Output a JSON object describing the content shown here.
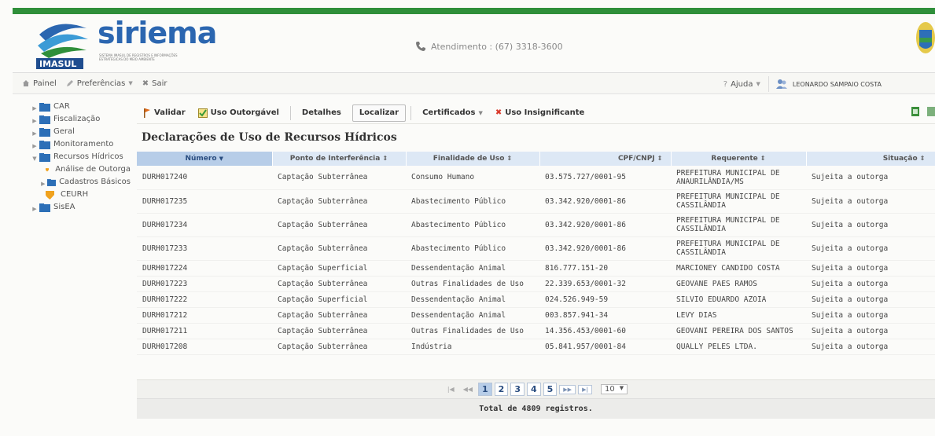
{
  "header": {
    "brand": "siriema",
    "logo_label": "IMASUL",
    "tagline": "Sistema Imasul de Registros e Informações Estratégicas do Meio Ambiente",
    "phone_text": "Atendimento : (67) 3318-3600"
  },
  "menubar": {
    "painel": "Painel",
    "preferencias": "Preferências",
    "sair": "Sair",
    "ajuda": "Ajuda",
    "user_name": "LEONARDO SAMPAIO COSTA"
  },
  "sidebar": {
    "car": "CAR",
    "fiscalizacao": "Fiscalização",
    "geral": "Geral",
    "monitoramento": "Monitoramento",
    "recursos_hidricos": "Recursos Hídricos",
    "analise_outorga": "Análise de Outorga",
    "cadastros_basicos": "Cadastros Básicos",
    "ceurh": "CEURH",
    "sisea": "SisEA"
  },
  "toolbar": {
    "validar": "Validar",
    "uso_outorgavel": "Uso Outorgável",
    "detalhes": "Detalhes",
    "localizar": "Localizar",
    "certificados": "Certificados",
    "uso_insignificante": "Uso Insignificante"
  },
  "page_title": "Declarações de Uso de Recursos Hídricos",
  "table": {
    "columns": [
      "Número",
      "Ponto de Interferência",
      "Finalidade de Uso",
      "CPF/CNPJ",
      "Requerente",
      "Situação"
    ],
    "rows": [
      [
        "DURH017240",
        "Captação Subterrânea",
        "Consumo Humano",
        "03.575.727/0001-95",
        "PREFEITURA MUNICIPAL DE ANAURILÂNDIA/MS",
        "Sujeita a outorga"
      ],
      [
        "DURH017235",
        "Captação Subterrânea",
        "Abastecimento Público",
        "03.342.920/0001-86",
        "PREFEITURA MUNICIPAL DE CASSILÂNDIA",
        "Sujeita a outorga"
      ],
      [
        "DURH017234",
        "Captação Subterrânea",
        "Abastecimento Público",
        "03.342.920/0001-86",
        "PREFEITURA MUNICIPAL DE CASSILÂNDIA",
        "Sujeita a outorga"
      ],
      [
        "DURH017233",
        "Captação Subterrânea",
        "Abastecimento Público",
        "03.342.920/0001-86",
        "PREFEITURA MUNICIPAL DE CASSILÂNDIA",
        "Sujeita a outorga"
      ],
      [
        "DURH017224",
        "Captação Superficial",
        "Dessendentação Animal",
        "816.777.151-20",
        "MARCIONEY CANDIDO COSTA",
        "Sujeita a outorga"
      ],
      [
        "DURH017223",
        "Captação Subterrânea",
        "Outras Finalidades de Uso",
        "22.339.653/0001-32",
        "GEOVANE PAES RAMOS",
        "Sujeita a outorga"
      ],
      [
        "DURH017222",
        "Captação Superficial",
        "Dessendentação Animal",
        "024.526.949-59",
        "SILVIO EDUARDO AZOIA",
        "Sujeita a outorga"
      ],
      [
        "DURH017212",
        "Captação Subterrânea",
        "Dessendentação Animal",
        "003.857.941-34",
        "LEVY DIAS",
        "Sujeita a outorga"
      ],
      [
        "DURH017211",
        "Captação Subterrânea",
        "Outras Finalidades de Uso",
        "14.356.453/0001-60",
        "GEOVANI PEREIRA DOS SANTOS",
        "Sujeita a outorga"
      ],
      [
        "DURH017208",
        "Captação Subterrânea",
        "Indústria",
        "05.841.957/0001-84",
        "QUALLY PELES LTDA.",
        "Sujeita a outorga"
      ]
    ]
  },
  "pager": {
    "pages": [
      "1",
      "2",
      "3",
      "4",
      "5"
    ],
    "current_page": "1",
    "rows_per_page": "10"
  },
  "total_text": "Total de 4809 registros.",
  "colors": {
    "brand_blue": "#2b66b0",
    "top_band_green": "#2f8f3a",
    "header_sorted": "#b7cde8",
    "header_bg": "#dde8f5",
    "insignificante_red": "#d9392b"
  }
}
